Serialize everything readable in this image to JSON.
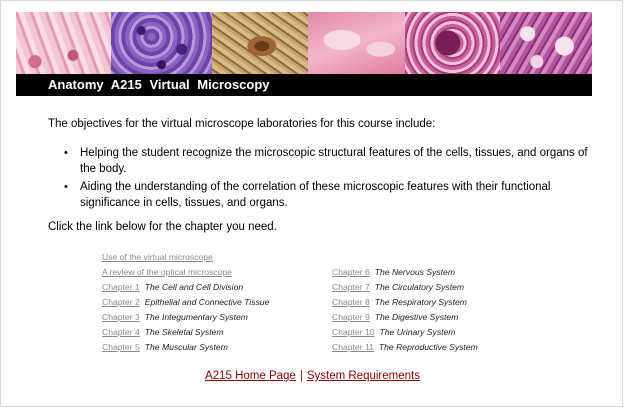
{
  "header": {
    "title": "Anatomy A215 Virtual Microscopy"
  },
  "banner": {
    "tiles": [
      "epithelium-image",
      "cell-cluster-image",
      "neuron-image",
      "cartilage-image",
      "glomerulus-image",
      "gland-image"
    ]
  },
  "main": {
    "intro": "The objectives for the virtual microscope laboratories for this course include:",
    "objectives": [
      "Helping the student recognize the microscopic structural features of the cells, tissues, and organs of the body.",
      "Aiding the understanding of the correlation of these microscopic features with their functional significance in cells, tissues, and organs."
    ],
    "bullet": "•",
    "click_text": "Click the link below for the chapter you need."
  },
  "links": {
    "use_vm": "Use of the virtual microscope",
    "review_optical": "A review of the optical microscope",
    "left_chapters": [
      {
        "link": "Chapter 1",
        "title": "The Cell and Cell Division"
      },
      {
        "link": "Chapter 2",
        "title": "Epithelial and Connective Tissue"
      },
      {
        "link": "Chapter 3",
        "title": "The Integumentary System"
      },
      {
        "link": "Chapter 4",
        "title": "The Skeletal System"
      },
      {
        "link": "Chapter 5",
        "title": "The Muscular System"
      }
    ],
    "right_chapters": [
      {
        "link": "Chapter 6",
        "title": "The Nervous System"
      },
      {
        "link": "Chapter 7",
        "title": "The Circulatory System"
      },
      {
        "link": "Chapter 8",
        "title": "The Respiratory System"
      },
      {
        "link": "Chapter 9",
        "title": "The Digestive System"
      },
      {
        "link": "Chapter 10",
        "title": "The Urinary System"
      },
      {
        "link": "Chapter 11",
        "title": "The Reproductive System"
      }
    ]
  },
  "footer": {
    "home": "A215 Home Page",
    "separator": "|",
    "requirements": "System Requirements"
  }
}
